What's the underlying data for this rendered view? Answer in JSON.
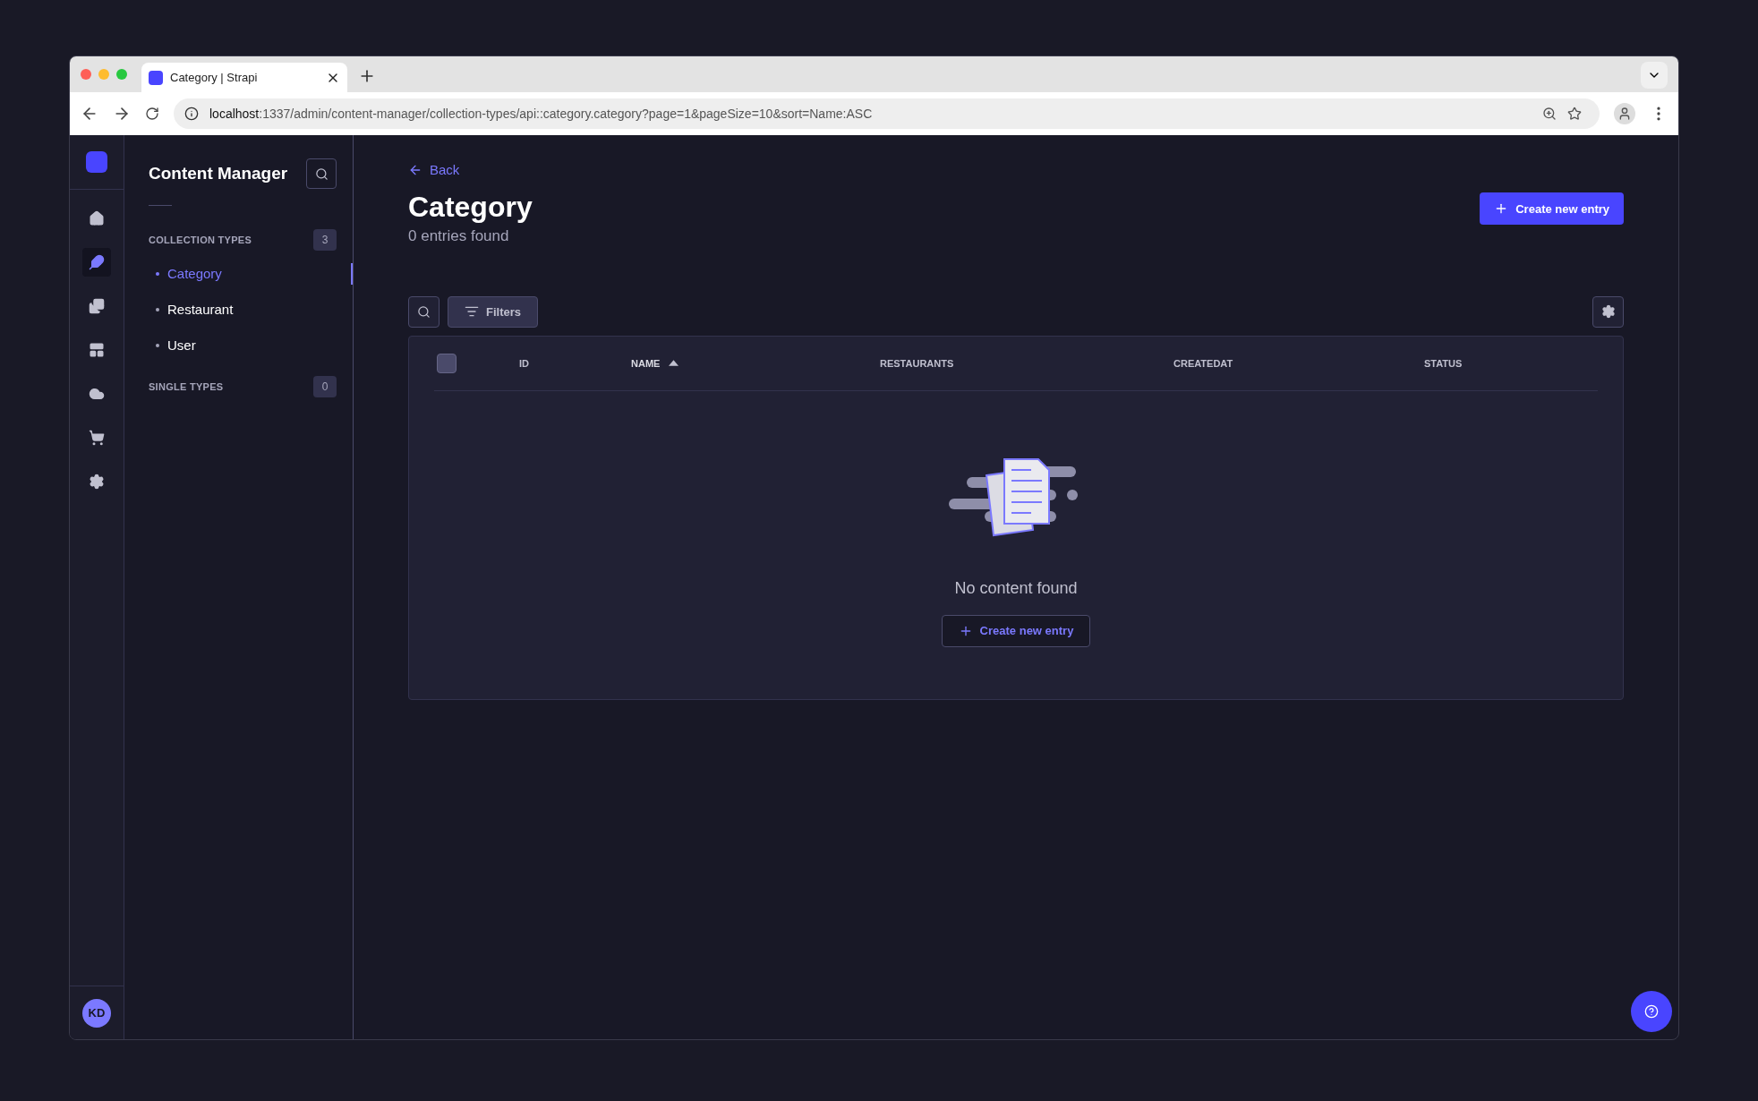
{
  "browser": {
    "tab_title": "Category | Strapi",
    "url_host": "localhost",
    "url_rest": ":1337/admin/content-manager/collection-types/api::category.category?page=1&pageSize=10&sort=Name:ASC"
  },
  "nav_rail": {
    "items": [
      {
        "selected": false
      },
      {
        "selected": true
      },
      {
        "selected": false
      },
      {
        "selected": false
      },
      {
        "selected": false
      },
      {
        "selected": false
      },
      {
        "selected": false
      }
    ],
    "avatar": "KD"
  },
  "sidebar": {
    "title": "Content Manager",
    "collection_types": {
      "label": "COLLECTION TYPES",
      "count": "3",
      "items": [
        {
          "label": "Category",
          "selected": true
        },
        {
          "label": "Restaurant",
          "selected": false
        },
        {
          "label": "User",
          "selected": false
        }
      ]
    },
    "single_types": {
      "label": "SINGLE TYPES",
      "count": "0"
    }
  },
  "main": {
    "back": "Back",
    "title": "Category",
    "subtitle": "0 entries found",
    "create_button": "Create new entry",
    "filters_button": "Filters",
    "table": {
      "select_all_checked": false,
      "columns": [
        {
          "label": "ID",
          "sorted": false
        },
        {
          "label": "NAME",
          "sorted": true
        },
        {
          "label": "RESTAURANTS",
          "sorted": false
        },
        {
          "label": "CREATEDAT",
          "sorted": false
        },
        {
          "label": "STATUS",
          "sorted": false
        }
      ],
      "empty_text": "No content found",
      "empty_button": "Create new entry"
    }
  }
}
